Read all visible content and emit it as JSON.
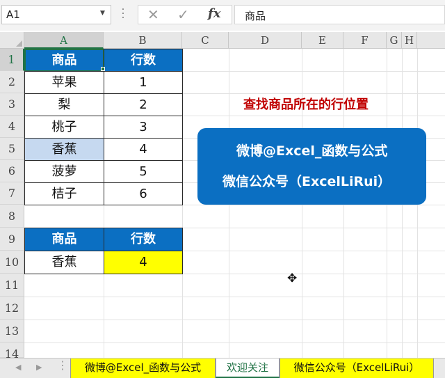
{
  "formula_bar": {
    "name_box": "A1",
    "cancel_icon": "✕",
    "enter_icon": "✓",
    "fx_label": "fx",
    "formula": "商品"
  },
  "columns": [
    "A",
    "B",
    "C",
    "D",
    "E",
    "F",
    "G",
    "H"
  ],
  "rows": [
    "1",
    "2",
    "3",
    "4",
    "5",
    "6",
    "7",
    "8",
    "9",
    "10",
    "11",
    "12",
    "13",
    "14"
  ],
  "table1": {
    "headers": [
      "商品",
      "行数"
    ],
    "rows": [
      [
        "苹果",
        "1"
      ],
      [
        "梨",
        "2"
      ],
      [
        "桃子",
        "3"
      ],
      [
        "香蕉",
        "4"
      ],
      [
        "菠萝",
        "5"
      ],
      [
        "桔子",
        "6"
      ]
    ]
  },
  "table2": {
    "headers": [
      "商品",
      "行数"
    ],
    "row": [
      "香蕉",
      "4"
    ]
  },
  "note": {
    "title": "查找商品所在的行位置"
  },
  "banner": {
    "line1": "微博@Excel_函数与公式",
    "line2": "微信公众号（ExcelLiRui）"
  },
  "tabs": [
    {
      "label": "微博@Excel_函数与公式"
    },
    {
      "label": "欢迎关注"
    },
    {
      "label": "微信公众号（ExcelLiRui）"
    }
  ],
  "colors": {
    "header_blue": "#0b6fc2",
    "highlight_yellow": "#ffff00",
    "title_red": "#c00000",
    "selection_green": "#217346"
  }
}
